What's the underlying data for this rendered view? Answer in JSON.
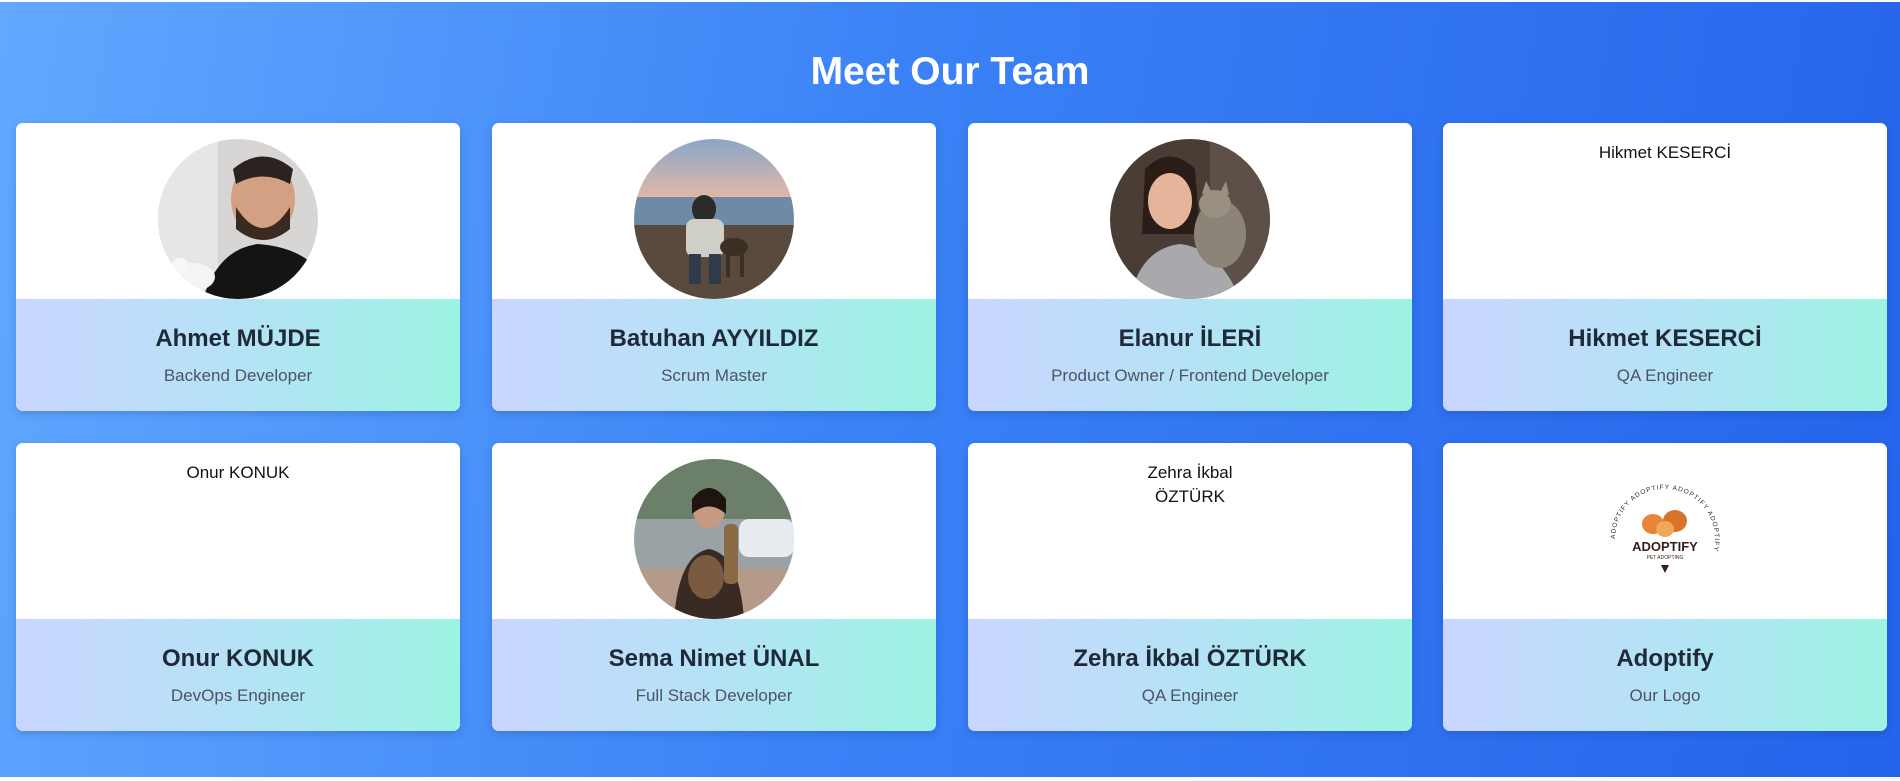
{
  "page": {
    "title": "Meet Our Team"
  },
  "team": [
    {
      "name": "Ahmet MÜJDE",
      "role": "Backend Developer",
      "photo": "photo"
    },
    {
      "name": "Batuhan AYYILDIZ",
      "role": "Scrum Master",
      "photo": "photo"
    },
    {
      "name": "Elanur İLERİ",
      "role": "Product Owner / Frontend Developer",
      "photo": "photo"
    },
    {
      "name": "Hikmet KESERCİ",
      "role": "QA Engineer",
      "photo_alt": "Hikmet KESERCİ"
    },
    {
      "name": "Onur KONUK",
      "role": "DevOps Engineer",
      "photo_alt": "Onur KONUK"
    },
    {
      "name": "Sema Nimet ÜNAL",
      "role": "Full Stack Developer",
      "photo": "photo"
    },
    {
      "name": "Zehra İkbal ÖZTÜRK",
      "role": "QA Engineer",
      "photo_alt": "Zehra İkbal ÖZTÜRK"
    },
    {
      "name": "Adoptify",
      "role": "Our Logo",
      "photo": "logo"
    }
  ],
  "logo": {
    "wordmark": "ADOPTIFY",
    "tagline": "PET ADOPTING",
    "ring_text": "ADOPTIFY ADOPTIFY ADOPTIFY ADOPTIFY",
    "colors": {
      "primary": "#3a1d1d",
      "accent": "#e8843a"
    }
  },
  "colors": {
    "background_start": "#62a8ff",
    "background_end": "#2563eb",
    "card_info_start": "#c9d6ff",
    "card_info_end": "#9cf3e3",
    "name_text": "#1f2937",
    "role_text": "#4b5563"
  }
}
